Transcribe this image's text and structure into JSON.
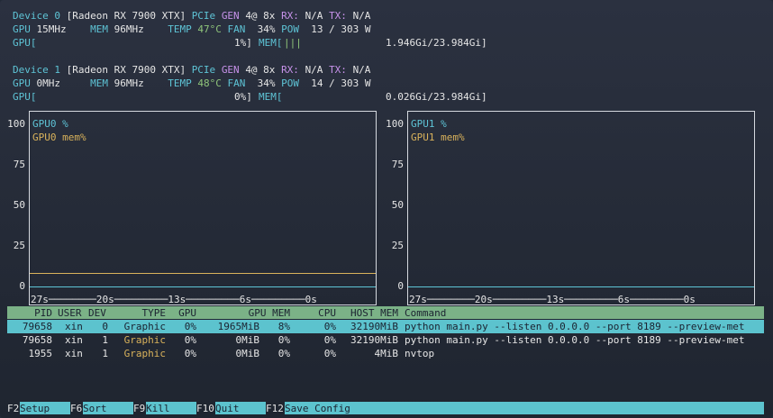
{
  "devices": [
    {
      "title_prefix": "Device 0",
      "title_name": "[Radeon RX 7900 XTX]",
      "pcie_label": "PCIe",
      "gen_label": "GEN",
      "gen_value": "4@ 8x",
      "rx_label": "RX:",
      "rx_value": "N/A",
      "tx_label": "TX:",
      "tx_value": "N/A",
      "gpu_label": "GPU",
      "gpu_clock": "15MHz",
      "mem_label": "MEM",
      "mem_clock": "96MHz",
      "temp_label": "TEMP",
      "temp_value": "47°C",
      "fan_label": "FAN",
      "fan_value": "34%",
      "pow_label": "POW",
      "pow_value": "13 / 303 W",
      "gpu_bar_open": "GPU[",
      "gpu_bar_pct": "1%]",
      "mem_bar_open": "MEM[",
      "mem_bar_fill": "|||",
      "mem_usage": "1.946Gi/23.984Gi]"
    },
    {
      "title_prefix": "Device 1",
      "title_name": "[Radeon RX 7900 XTX]",
      "pcie_label": "PCIe",
      "gen_label": "GEN",
      "gen_value": "4@ 8x",
      "rx_label": "RX:",
      "rx_value": "N/A",
      "tx_label": "TX:",
      "tx_value": "N/A",
      "gpu_label": "GPU",
      "gpu_clock": "0MHz",
      "mem_label": "MEM",
      "mem_clock": "96MHz",
      "temp_label": "TEMP",
      "temp_value": "48°C",
      "fan_label": "FAN",
      "fan_value": "34%",
      "pow_label": "POW",
      "pow_value": "14 / 303 W",
      "gpu_bar_open": "GPU[",
      "gpu_bar_pct": "0%]",
      "mem_bar_open": "MEM[",
      "mem_bar_fill": "",
      "mem_usage": "0.026Gi/23.984Gi]"
    }
  ],
  "charts": [
    {
      "legend_util": "GPU0 %",
      "legend_mem": "GPU0 mem%",
      "y_ticks": [
        "100",
        "75",
        "50",
        "25",
        "0"
      ],
      "x_axis": "27s────────20s─────────13s─────────6s─────────0s",
      "util_pct": 0,
      "mem_pct": 8
    },
    {
      "legend_util": "GPU1 %",
      "legend_mem": "GPU1 mem%",
      "y_ticks": [
        "100",
        "75",
        "50",
        "25",
        "0"
      ],
      "x_axis": "27s────────20s─────────13s─────────6s─────────0s",
      "util_pct": 0,
      "mem_pct": 0
    }
  ],
  "table": {
    "headers": [
      "PID",
      "USER",
      "DEV",
      "TYPE",
      "GPU",
      "GPU MEM",
      "CPU",
      "HOST MEM",
      "Command"
    ],
    "rows": [
      [
        "79658",
        "xin",
        "0",
        "Graphic",
        "0%",
        "1965MiB",
        "8%",
        "0%",
        "32190MiB",
        "python main.py --listen 0.0.0.0 --port 8189 --preview-met"
      ],
      [
        "79658",
        "xin",
        "1",
        "Graphic",
        "0%",
        "0MiB",
        "0%",
        "0%",
        "32190MiB",
        "python main.py --listen 0.0.0.0 --port 8189 --preview-met"
      ],
      [
        "1955",
        "xin",
        "1",
        "Graphic",
        "0%",
        "0MiB",
        "0%",
        "0%",
        "4MiB",
        "nvtop"
      ]
    ]
  },
  "footer": [
    {
      "key": "F2",
      "label": "Setup"
    },
    {
      "key": "F6",
      "label": "Sort"
    },
    {
      "key": "F9",
      "label": "Kill"
    },
    {
      "key": "F10",
      "label": "Quit"
    },
    {
      "key": "F12",
      "label": "Save Config"
    }
  ],
  "colors": {
    "util_line": "#5ec4d6",
    "mem_line": "#d9b25b",
    "selected_row": "#5cc3ce",
    "header_bar": "#7bb287"
  }
}
